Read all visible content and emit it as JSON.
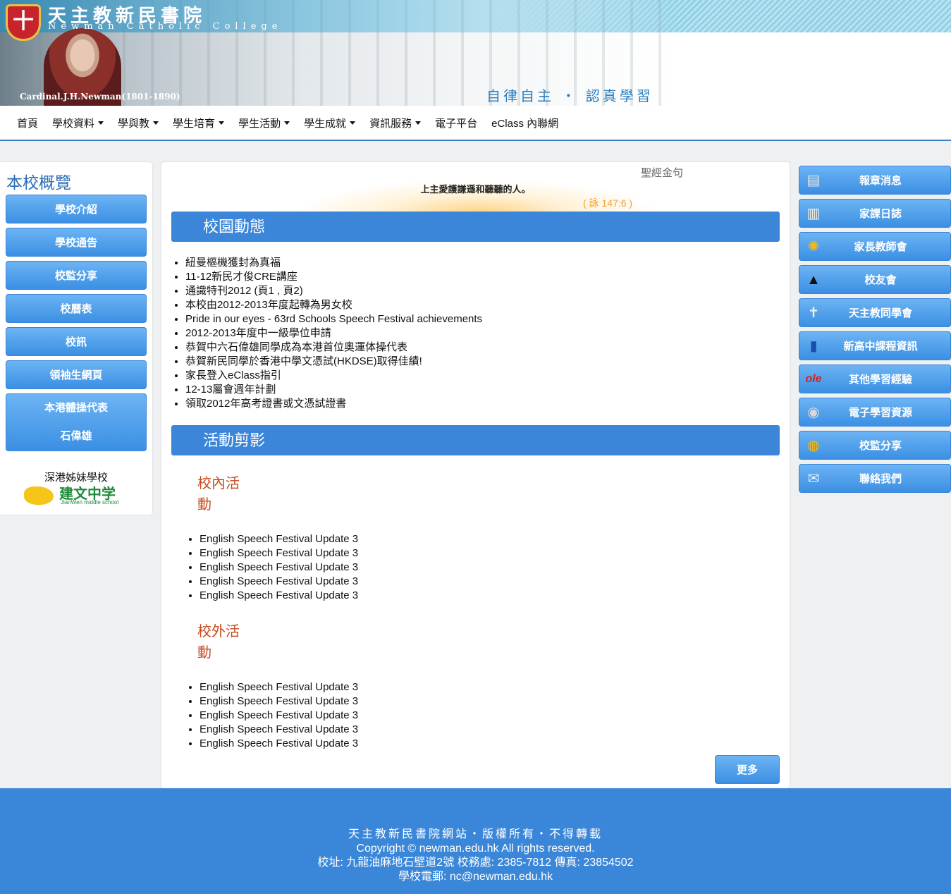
{
  "header": {
    "title_cn": "天主教新民書院",
    "title_en": "Newman Catholic College",
    "cardinal": "Cardinal.J.H.Newman(1801-1890)",
    "motto": "自律自主 ・ 認真學習",
    "crest_glyph": "十"
  },
  "nav": {
    "items": [
      {
        "label": "首頁",
        "dropdown": false
      },
      {
        "label": "學校資料",
        "dropdown": true
      },
      {
        "label": "學與教",
        "dropdown": true
      },
      {
        "label": "學生培育",
        "dropdown": true
      },
      {
        "label": "學生活動",
        "dropdown": true
      },
      {
        "label": "學生成就",
        "dropdown": true
      },
      {
        "label": "資訊服務",
        "dropdown": true
      },
      {
        "label": "電子平台",
        "dropdown": false
      },
      {
        "label": "eClass 內聯網",
        "dropdown": false
      }
    ]
  },
  "left": {
    "title": "本校概覽",
    "buttons": [
      "學校介紹",
      "學校通告",
      "校監分享",
      "校曆表",
      "校訊",
      "領袖生網頁"
    ],
    "tall_button": {
      "line1": "本港體操代表",
      "line2": "石偉雄"
    },
    "sister_label": "深港姊妹學校",
    "sister_logo_cn": "建文中学",
    "sister_logo_en": "JianWen middle school"
  },
  "main": {
    "verse_label": "聖經金句",
    "verse_text": "上主愛護謙遜和聽聽的人。",
    "verse_ref": "( 詠 147:6 )",
    "news_title": "校園動態",
    "news_items": [
      "紐曼樞機獲封為真福",
      "11-12新民才俊CRE講座",
      "通識特刊2012 (頁1 , 頁2)",
      "本校由2012-2013年度起轉為男女校",
      "Pride in our eyes - 63rd Schools Speech Festival achievements",
      "2012-2013年度中一級學位申請",
      "恭賀中六石偉雄同學成為本港首位奧運体操代表",
      "恭賀新民同學於香港中學文憑試(HKDSE)取得佳績!",
      "家長登入eClass指引",
      "12-13屬會週年計劃",
      "領取2012年高考證書或文憑試證書"
    ],
    "gallery_title": "活動剪影",
    "inside_title_1": "校內活",
    "inside_title_2": "動",
    "inside_items": [
      "English Speech Festival Update 3",
      "English Speech Festival Update 3",
      "English Speech Festival Update 3",
      "English Speech Festival Update 3",
      "English Speech Festival Update 3"
    ],
    "outside_title_1": "校外活",
    "outside_title_2": "動",
    "outside_items": [
      "English Speech Festival Update 3",
      "English Speech Festival Update 3",
      "English Speech Festival Update 3",
      "English Speech Festival Update 3",
      "English Speech Festival Update 3"
    ],
    "more_label": "更多"
  },
  "right": {
    "buttons": [
      {
        "label": "報章消息",
        "icon": "newspaper-icon",
        "glyph": "▤"
      },
      {
        "label": "家課日誌",
        "icon": "open-book-icon",
        "glyph": "▥"
      },
      {
        "label": "家長教師會",
        "icon": "sunflower-icon",
        "glyph": "✺"
      },
      {
        "label": "校友會",
        "icon": "graduation-cap-icon",
        "glyph": "▲"
      },
      {
        "label": "天主教同學會",
        "icon": "cross-icon",
        "glyph": "✝"
      },
      {
        "label": "新高中課程資訊",
        "icon": "book-icon",
        "glyph": "▮"
      },
      {
        "label": "其他學習經驗",
        "icon": "ole-logo-icon",
        "glyph": "ole"
      },
      {
        "label": "電子學習資源",
        "icon": "disc-icon",
        "glyph": "◉"
      },
      {
        "label": "校監分享",
        "icon": "speech-bubble-icon",
        "glyph": "◍"
      },
      {
        "label": "聯絡我們",
        "icon": "mail-icon",
        "glyph": "✉"
      }
    ]
  },
  "footer": {
    "line1": "天主教新民書院網站・版權所有・不得轉載",
    "line2": "Copyright © newman.edu.hk  All rights reserved.",
    "line3": "校址: 九龍油麻地石壁道2號    校務處: 2385-7812    傳真: 23854502",
    "line4": "學校電郵: nc@newman.edu.hk"
  },
  "colors": {
    "accent": "#3b86d8",
    "nav_border": "#3a7fc5",
    "sub_heading": "#c84a1e",
    "verse_ref": "#f0a030",
    "page_bg": "#eef0f1"
  }
}
